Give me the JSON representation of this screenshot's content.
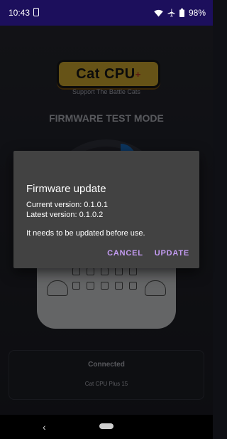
{
  "status_bar": {
    "time": "10:43",
    "battery": "98%"
  },
  "app": {
    "logo_main": "Cat CPU",
    "logo_plus": "+",
    "tagline": "Support The Battle Cats",
    "mode_title": "FIRMWARE TEST MODE",
    "connection": {
      "status": "Connected",
      "device": "Cat CPU Plus 15"
    }
  },
  "dialog": {
    "title": "Firmware update",
    "current_version": "Current version: 0.1.0.1",
    "latest_version": "Latest version: 0.1.0.2",
    "message": "It needs to be updated before use.",
    "cancel_label": "CANCEL",
    "update_label": "UPDATE"
  },
  "nav": {
    "back_glyph": "‹"
  },
  "colors": {
    "status_bar_bg": "#1c0f5c",
    "dialog_bg": "#424242",
    "accent": "#c39bf2"
  }
}
